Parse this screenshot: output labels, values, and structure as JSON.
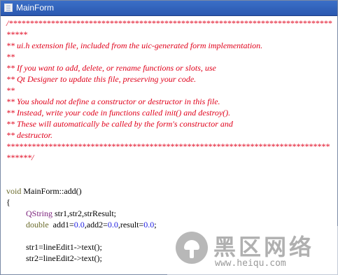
{
  "window": {
    "title": "MainForm"
  },
  "code": {
    "comment_lines": [
      "/*****************************************************************************",
      "*****",
      "** ui.h extension file, included from the uic-generated form implementation.",
      "**",
      "** If you want to add, delete, or rename functions or slots, use",
      "** Qt Designer to update this file, preserving your code.",
      "**",
      "** You should not define a constructor or destructor in this file.",
      "** Instead, write your code in functions called init() and destroy().",
      "** These will automatically be called by the form's constructor and",
      "** destructor.",
      "*****************************************************************************",
      "******/"
    ],
    "func_keyword": "void",
    "func_name": " MainForm::add()",
    "open_brace": "{",
    "decl1_type": "QString",
    "decl1_rest": " str1,str2,strResult;",
    "decl2_type": "double",
    "decl2_a": "  add1=",
    "decl2_v1": "0.0",
    "decl2_b": ",add2=",
    "decl2_v2": "0.0",
    "decl2_c": ",result=",
    "decl2_v3": "0.0",
    "decl2_end": ";",
    "stmt1": "str1=lineEdit1->text();",
    "stmt2": "str2=lineEdit2->text();"
  },
  "watermark": {
    "name": "黑区网络",
    "url": "www.heiqu.com"
  }
}
